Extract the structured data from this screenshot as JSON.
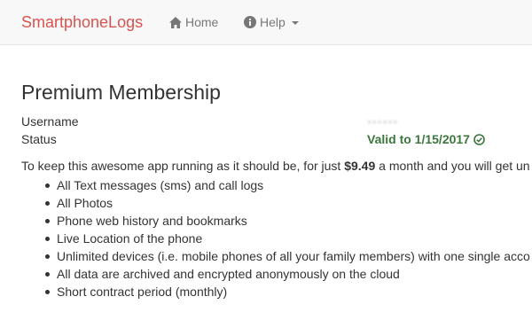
{
  "navbar": {
    "brand": "SmartphoneLogs",
    "home_label": "Home",
    "help_label": "Help",
    "brand_color": "#d9534f",
    "home_icon": "home-icon",
    "help_icon": "info-circle-icon"
  },
  "page": {
    "title": "Premium Membership",
    "fields": {
      "username_label": "Username",
      "username_value": "••••••",
      "status_label": "Status",
      "status_value": "Valid to 1/15/2017",
      "status_color": "#3c763d",
      "status_icon": "check-circle-icon"
    },
    "intro_prefix": "To keep this awesome app running as it should be, for just ",
    "intro_price": "$9.49",
    "intro_suffix": " a month and you will get un",
    "features": [
      "All Text messages (sms) and call logs",
      "All Photos",
      "Phone web history and bookmarks",
      "Live Location of the phone",
      "Unlimited devices (i.e. mobile phones of all your family members) with one single acco",
      "All data are archived and encrypted anonymously on the cloud",
      "Short contract period (monthly)"
    ]
  }
}
